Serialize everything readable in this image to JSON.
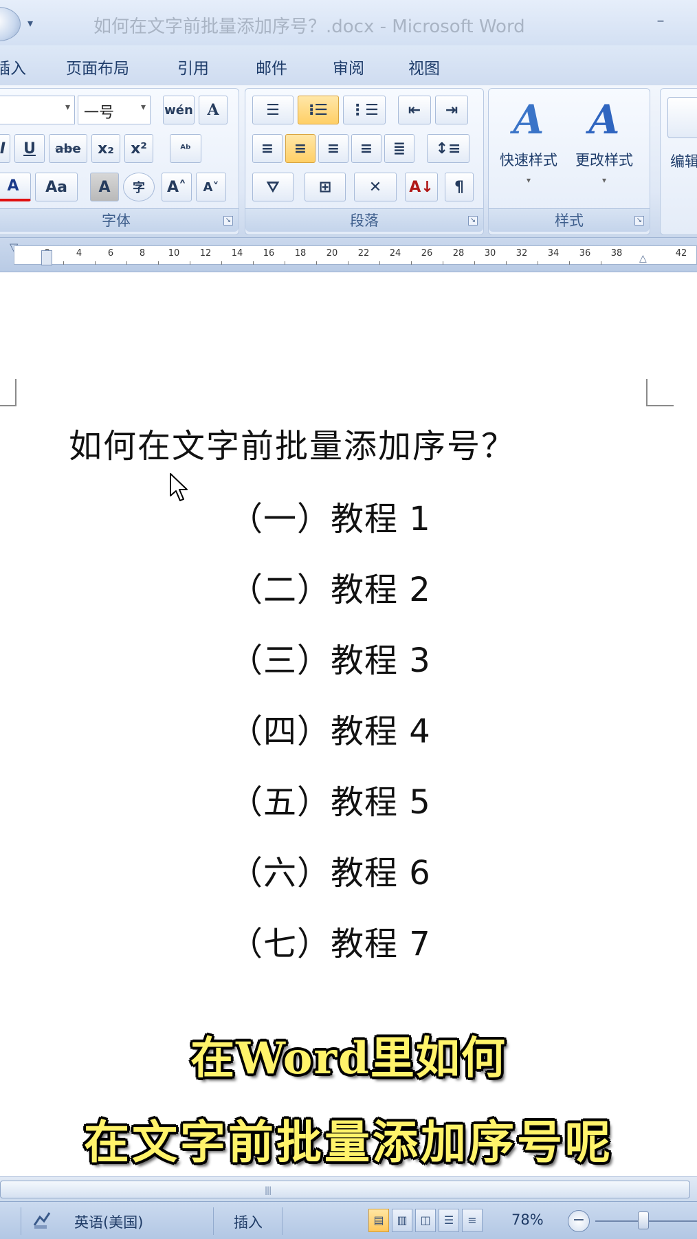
{
  "window": {
    "title": "如何在文字前批量添加序号？.docx - Microsoft Word",
    "minimize_glyph": "–",
    "qat_glyph": "▾"
  },
  "ribbon_tabs": [
    "插入",
    "页面布局",
    "引用",
    "邮件",
    "审阅",
    "视图"
  ],
  "ribbon": {
    "font_group": {
      "label": "字体",
      "font_size": "一号",
      "row1": [
        "wén",
        "A"
      ],
      "row2": [
        "I",
        "U",
        "abe",
        "x₂",
        "x²",
        "ᴬᵇ"
      ],
      "row3": [
        "A",
        "Aa",
        "A",
        "字",
        "A˄",
        "A˅"
      ]
    },
    "paragraph_group": {
      "label": "段落",
      "row1": [
        "☰",
        "⁝☰",
        "⋮☰",
        "⇤",
        "⇥"
      ],
      "row2": [
        "≡",
        "≡",
        "≡",
        "≡",
        "≣",
        "↕≡"
      ],
      "row3": [
        "⛛",
        "⊞",
        "✕",
        "A↓",
        "¶"
      ]
    },
    "styles_group": {
      "label": "样式",
      "quick_styles": "快速样式",
      "change_styles": "更改样式"
    },
    "editing_group": {
      "label": "编辑"
    }
  },
  "ruler": {
    "labels": [
      "2",
      "4",
      "6",
      "8",
      "10",
      "12",
      "14",
      "16",
      "18",
      "20",
      "22",
      "24",
      "26",
      "28",
      "30",
      "32",
      "34",
      "36",
      "38",
      "42"
    ]
  },
  "document": {
    "heading": "如何在文字前批量添加序号？",
    "list": [
      "（一）教程 1",
      "（二）教程 2",
      "（三）教程 3",
      "（四）教程 4",
      "（五）教程 5",
      "（六）教程 6",
      "（七）教程 7"
    ]
  },
  "caption": {
    "line1": "在Word里如何",
    "line2": "在文字前批量添加序号呢"
  },
  "statusbar": {
    "language": "英语(美国)",
    "mode": "插入",
    "zoom": "78%",
    "zoom_out": "−"
  },
  "colors": {
    "caption_fill": "#fff36a",
    "ribbon_active": "#ffcf66",
    "chrome_blue": "#cfdcf0"
  }
}
